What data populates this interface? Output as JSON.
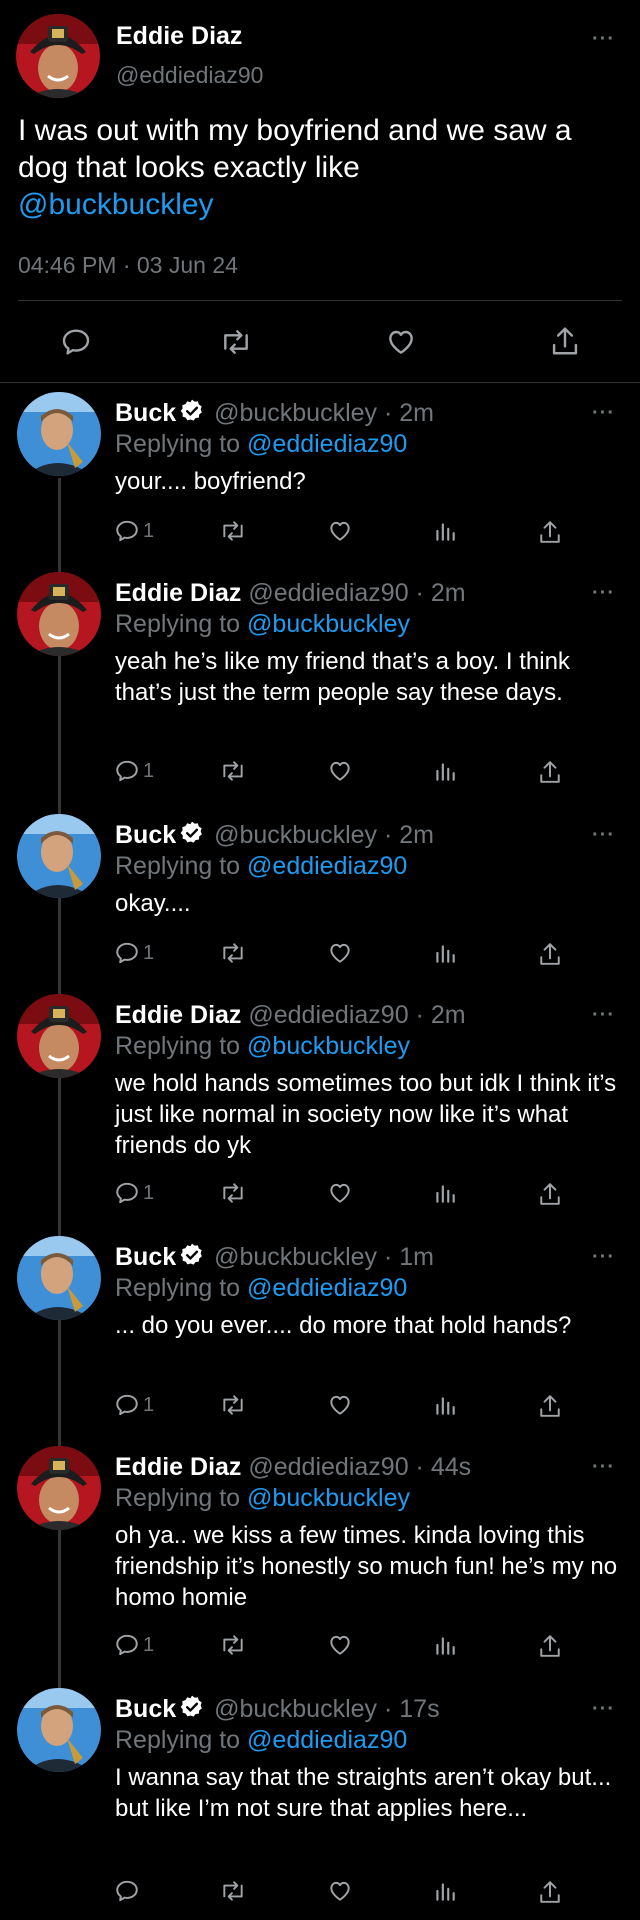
{
  "main": {
    "author": "Eddie Diaz",
    "handle": "@eddiediaz90",
    "text": "I was out with my boyfriend and we saw a dog that looks exactly like",
    "mention": "@buckbuckley",
    "timestamp": "04:46 PM · 03 Jun 24"
  },
  "more_label": "···",
  "replies": [
    {
      "author": "Buck",
      "handle": "@buckbuckley",
      "time": "· 2m",
      "verified": true,
      "replying_prefix": "Replying to ",
      "replying_to": "@eddiediaz90",
      "text": "your.... boyfriend?",
      "reply_count": "1"
    },
    {
      "author": "Eddie Diaz",
      "handle": "@eddiediaz90",
      "time": "· 2m",
      "verified": false,
      "replying_prefix": "Replying to ",
      "replying_to": "@buckbuckley",
      "text": "yeah he’s like my friend that’s a boy. I think that’s just the term people say these days.",
      "reply_count": "1"
    },
    {
      "author": "Buck",
      "handle": "@buckbuckley",
      "time": "· 2m",
      "verified": true,
      "replying_prefix": "Replying to ",
      "replying_to": "@eddiediaz90",
      "text": "okay....",
      "reply_count": "1"
    },
    {
      "author": "Eddie Diaz",
      "handle": "@eddiediaz90",
      "time": "· 2m",
      "verified": false,
      "replying_prefix": "Replying to ",
      "replying_to": "@buckbuckley",
      "text": "we hold hands sometimes too but idk I think it’s just like normal in society now like it’s what friends do yk",
      "reply_count": "1"
    },
    {
      "author": "Buck",
      "handle": "@buckbuckley",
      "time": "· 1m",
      "verified": true,
      "replying_prefix": "Replying to ",
      "replying_to": "@eddiediaz90",
      "text": "... do you ever.... do more that hold hands?",
      "reply_count": "1"
    },
    {
      "author": "Eddie Diaz",
      "handle": "@eddiediaz90",
      "time": "· 44s",
      "verified": false,
      "replying_prefix": "Replying to ",
      "replying_to": "@buckbuckley",
      "text": "oh ya.. we kiss a few times. kinda loving this friendship it’s honestly so much fun! he’s my no homo homie",
      "reply_count": "1"
    },
    {
      "author": "Buck",
      "handle": "@buckbuckley",
      "time": "· 17s",
      "verified": true,
      "replying_prefix": "Replying to ",
      "replying_to": "@eddiediaz90",
      "text": "I wanna say that the straights aren’t okay but... but like I’m not sure that applies here...",
      "reply_count": ""
    }
  ],
  "icons": {
    "reply": "reply-icon",
    "retweet": "retweet-icon",
    "like": "heart-icon",
    "views": "views-icon",
    "share": "share-icon",
    "more": "more-icon",
    "verified": "verified-badge-icon"
  },
  "colors": {
    "background": "#000000",
    "text": "#e7e9ea",
    "muted": "#71767b",
    "accent": "#1d9bf0",
    "separator": "#2f3336"
  }
}
